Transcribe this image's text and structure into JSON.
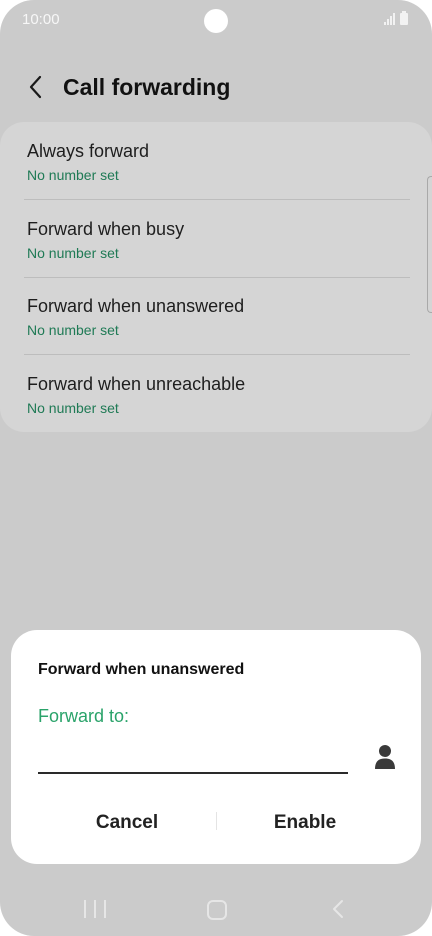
{
  "status_bar": {
    "time": "10:00"
  },
  "header": {
    "title": "Call forwarding",
    "back_icon": "chevron-left-icon"
  },
  "settings": {
    "items": [
      {
        "title": "Always forward",
        "subtitle": "No number set"
      },
      {
        "title": "Forward when busy",
        "subtitle": "No number set"
      },
      {
        "title": "Forward when unanswered",
        "subtitle": "No number set"
      },
      {
        "title": "Forward when unreachable",
        "subtitle": "No number set"
      }
    ]
  },
  "dialog": {
    "title": "Forward when unanswered",
    "field_label": "Forward to:",
    "field_value": "",
    "contact_icon": "person-icon",
    "cancel_label": "Cancel",
    "enable_label": "Enable"
  },
  "colors": {
    "accent_green": "#2aa36a",
    "subtitle_green": "#1f7a55",
    "overlay_gray": "#cbcbcb"
  }
}
